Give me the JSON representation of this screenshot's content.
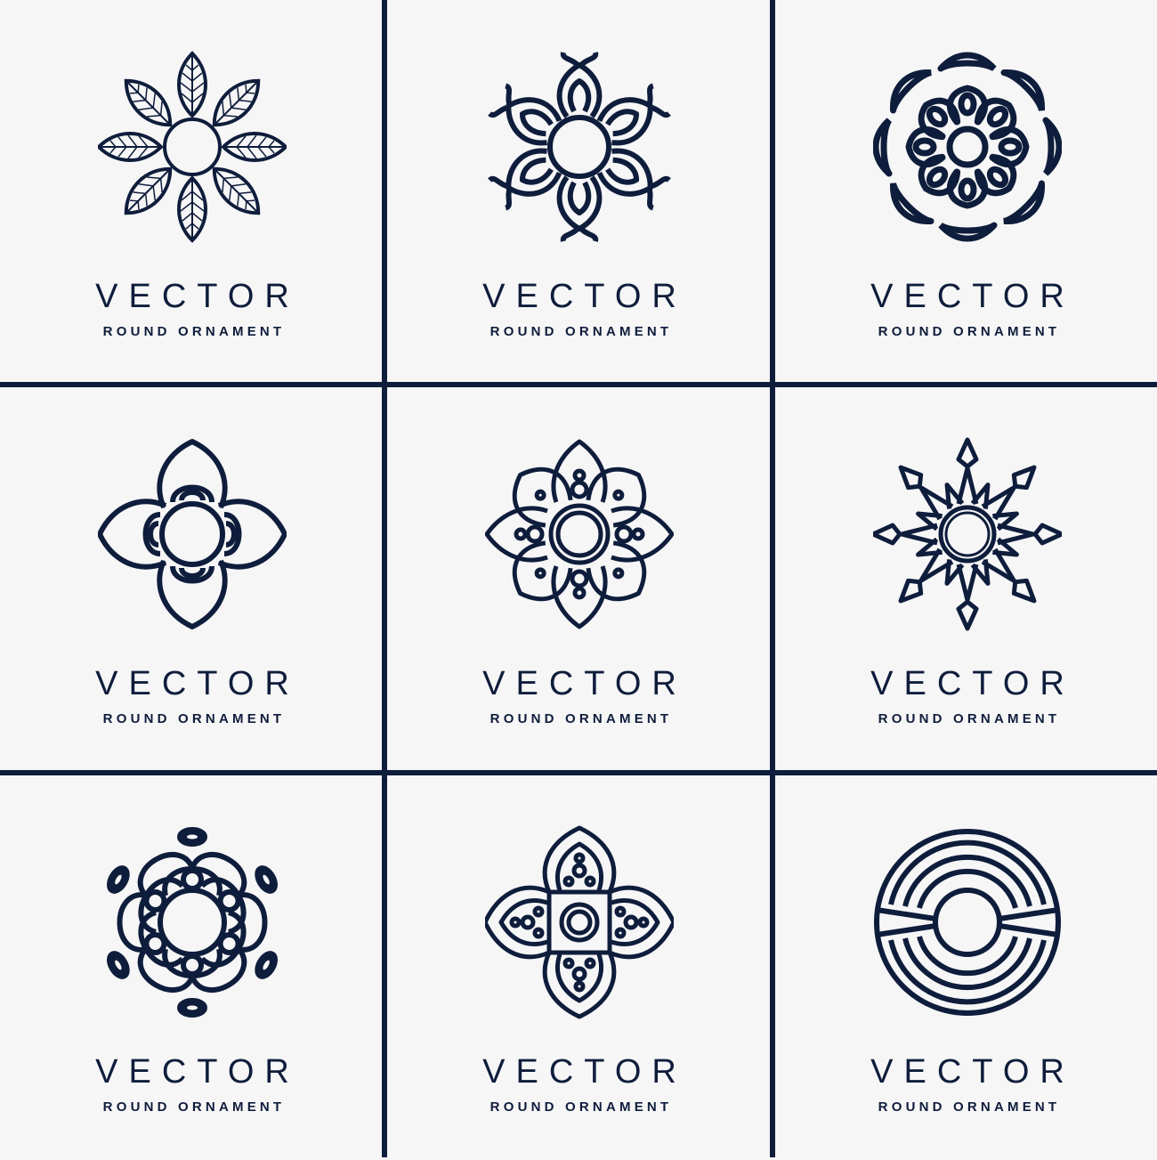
{
  "colors": {
    "ink": "#0f1d3c",
    "background": "#f6f6f6"
  },
  "cards": [
    {
      "icon": "leaf-flower-icon",
      "title": "VECTOR",
      "subtitle": "ROUND ORNAMENT"
    },
    {
      "icon": "heart-lotus-icon",
      "title": "VECTOR",
      "subtitle": "ROUND ORNAMENT"
    },
    {
      "icon": "swirl-rosette-icon",
      "title": "VECTOR",
      "subtitle": "ROUND ORNAMENT"
    },
    {
      "icon": "four-petal-arc-icon",
      "title": "VECTOR",
      "subtitle": "ROUND ORNAMENT"
    },
    {
      "icon": "jeweled-lotus-icon",
      "title": "VECTOR",
      "subtitle": "ROUND ORNAMENT"
    },
    {
      "icon": "spiky-star-icon",
      "title": "VECTOR",
      "subtitle": "ROUND ORNAMENT"
    },
    {
      "icon": "scallop-medallion-icon",
      "title": "VECTOR",
      "subtitle": "ROUND ORNAMENT"
    },
    {
      "icon": "filigree-cross-icon",
      "title": "VECTOR",
      "subtitle": "ROUND ORNAMENT"
    },
    {
      "icon": "concentric-circle-icon",
      "title": "VECTOR",
      "subtitle": "ROUND ORNAMENT"
    }
  ]
}
